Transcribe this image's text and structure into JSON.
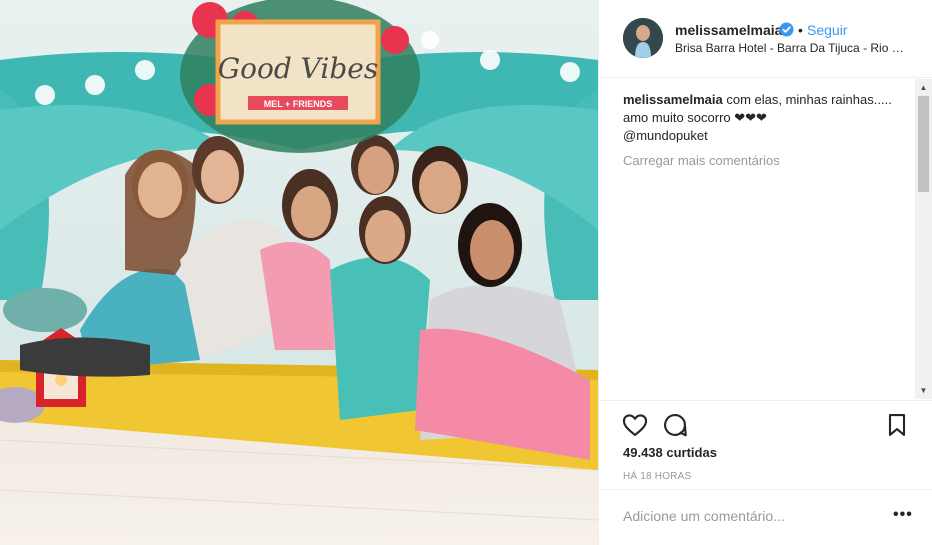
{
  "post": {
    "image_alt": "Photo by melissamelmaia",
    "sign_title": "Good Vibes",
    "sign_subtitle": "MEL + FRIENDS"
  },
  "header": {
    "username": "melissamelmaia",
    "separator": "•",
    "follow_label": "Seguir",
    "location": "Brisa Barra Hotel - Barra Da Tijuca - Rio De Janeiro"
  },
  "caption": {
    "username": "melissamelmaia",
    "text": " com elas, minhas rainhas..... amo muito socorro ❤❤❤",
    "mention": "@mundopuket"
  },
  "load_more_label": "Carregar mais comentários",
  "stats": {
    "likes": "49.438 curtidas",
    "timestamp": "HÁ 18 HORAS"
  },
  "comment_box": {
    "placeholder": "Adicione um comentário...",
    "more_label": "•••"
  },
  "icons": [
    "heart-icon",
    "comment-icon",
    "bookmark-icon",
    "verified-badge-icon",
    "more-options-icon"
  ],
  "colors": {
    "link": "#3897f0",
    "verified": "#3897f0",
    "text": "#262626",
    "muted": "#999999"
  }
}
